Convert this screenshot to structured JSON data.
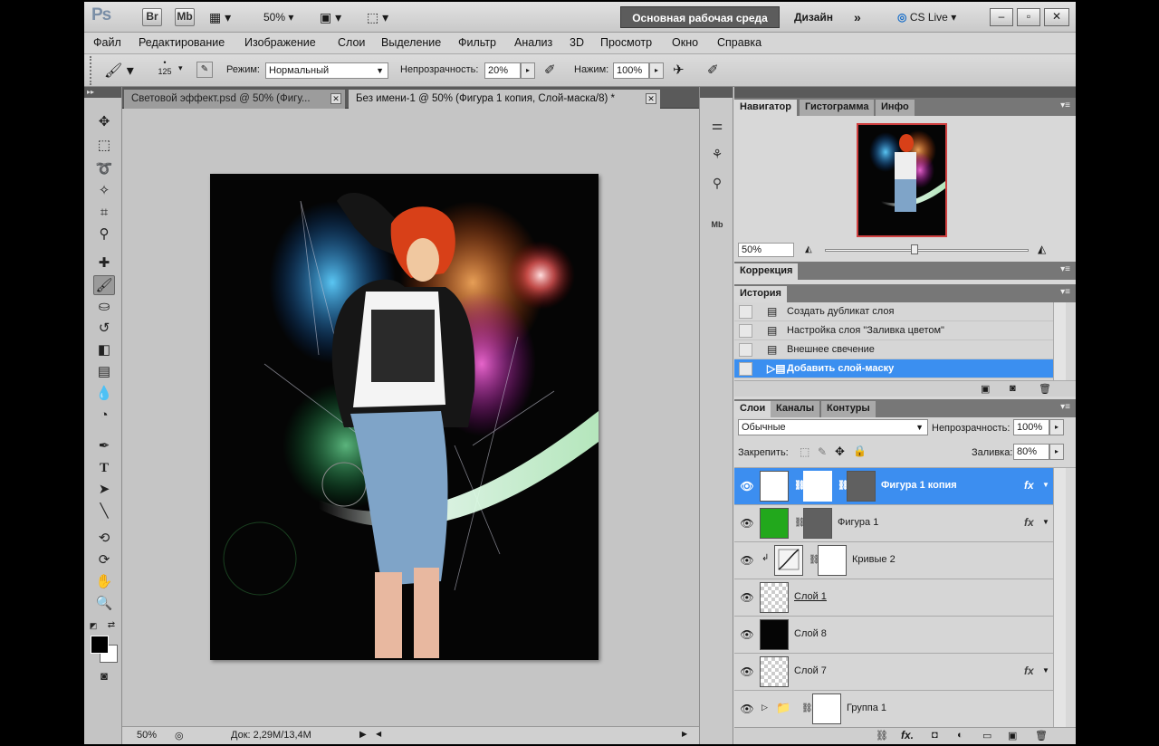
{
  "appbar": {
    "logo": "Ps",
    "br": "Br",
    "mb": "Mb",
    "zoom": "50%",
    "workspace": "Основная рабочая среда",
    "design": "Дизайн",
    "more": "»",
    "cs_live": "CS Live"
  },
  "menu": [
    "Файл",
    "Редактирование",
    "Изображение",
    "Слои",
    "Выделение",
    "Фильтр",
    "Анализ",
    "3D",
    "Просмотр",
    "Окно",
    "Справка"
  ],
  "options": {
    "brush_size": "125",
    "mode_label": "Режим:",
    "mode_value": "Нормальный",
    "opacity_label": "Непрозрачность:",
    "opacity_value": "20%",
    "pressure_label": "Нажим:",
    "pressure_value": "100%"
  },
  "tabs": [
    {
      "label": "Световой эффект.psd @ 50% (Фигу..."
    },
    {
      "label": "Без имени-1 @ 50% (Фигура 1 копия, Слой-маска/8) *"
    }
  ],
  "status": {
    "zoom": "50%",
    "doc": "Док: 2,29M/13,4M"
  },
  "navigator": {
    "tabs": [
      "Навигатор",
      "Гистограмма",
      "Инфо"
    ],
    "zoom": "50%"
  },
  "correction": {
    "title": "Коррекция"
  },
  "history": {
    "title": "История",
    "items": [
      "Создать дубликат слоя",
      "Настройка слоя \"Заливка цветом\"",
      "Внешнее свечение",
      "Добавить слой-маску"
    ]
  },
  "layers": {
    "tabs": [
      "Слои",
      "Каналы",
      "Контуры"
    ],
    "blend_mode": "Обычные",
    "opacity_label": "Непрозрачность:",
    "opacity_value": "100%",
    "lock_label": "Закрепить:",
    "fill_label": "Заливка:",
    "fill_value": "80%",
    "items": [
      {
        "name": "Фигура 1 копия"
      },
      {
        "name": "Фигура 1"
      },
      {
        "name": "Кривые 2"
      },
      {
        "name": "Слой 1"
      },
      {
        "name": "Слой 8"
      },
      {
        "name": "Слой 7"
      },
      {
        "name": "Группа 1"
      }
    ]
  },
  "colors": {
    "accent": "#3c8ef0",
    "workspace": "#5c5c5c",
    "selection_border": "#d04040"
  }
}
